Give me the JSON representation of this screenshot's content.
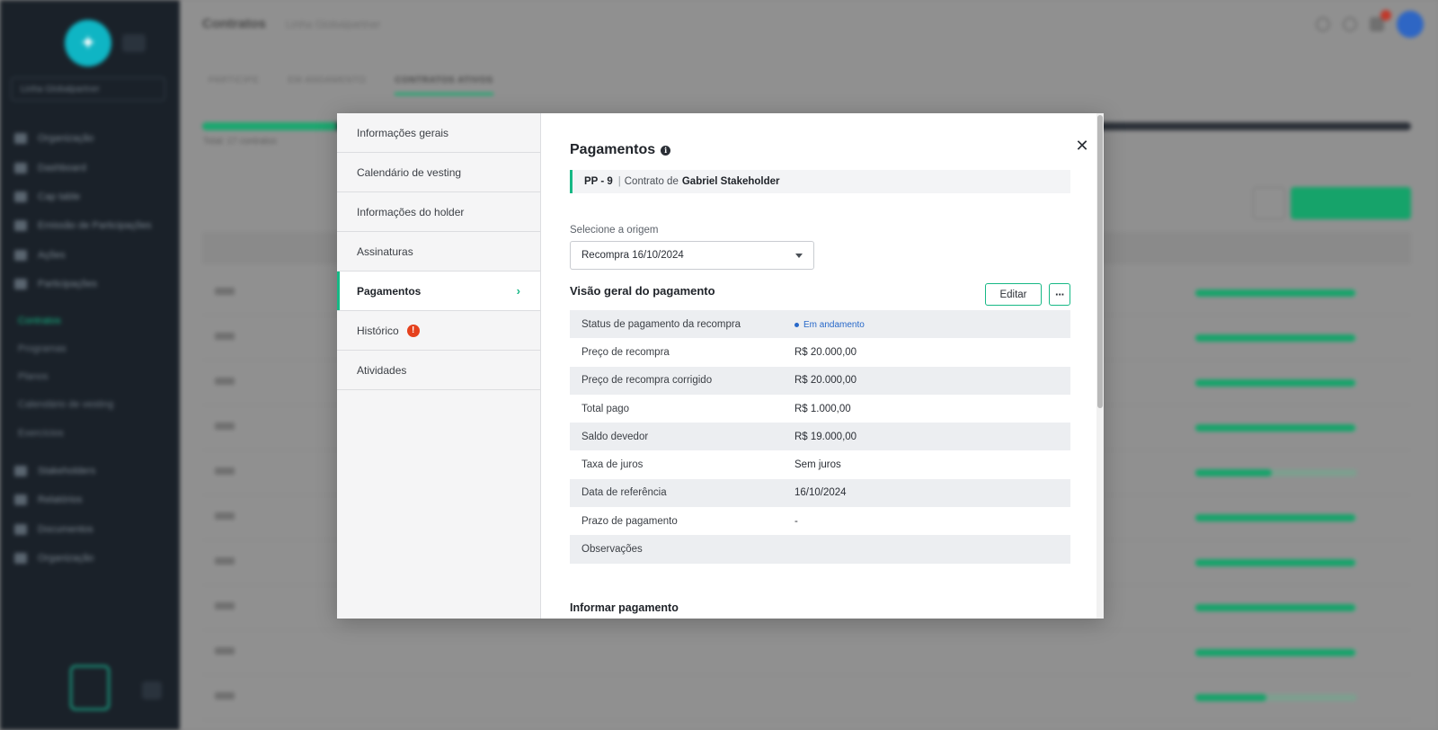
{
  "background": {
    "page_title": "Contratos",
    "page_subtitle": "Linha Globalpartner",
    "tabs": [
      "PARTICIPE",
      "EM ANDAMENTO",
      "CONTRATOS ATIVOS"
    ],
    "total_label": "Total: 17 contratos",
    "sidebar": {
      "org_select": "Linha Globalpartner",
      "items": [
        "Organização",
        "Dashboard",
        "Cap table",
        "Emissão de Participações",
        "Ações",
        "Participações"
      ],
      "sub_items": [
        "Contratos",
        "Programas",
        "Planos",
        "Calendário de vesting",
        "Exercícios"
      ],
      "bottom_items": [
        "Stakeholders",
        "Relatórios",
        "Documentos",
        "Organização"
      ]
    },
    "row_progress": [
      0.99,
      0.99,
      0.99,
      0.99,
      0.47,
      0.99,
      0.99,
      0.99,
      0.99,
      0.44
    ]
  },
  "modal": {
    "nav": [
      {
        "label": "Informações gerais"
      },
      {
        "label": "Calendário de vesting"
      },
      {
        "label": "Informações do holder"
      },
      {
        "label": "Assinaturas"
      },
      {
        "label": "Pagamentos"
      },
      {
        "label": "Histórico"
      },
      {
        "label": "Atividades"
      }
    ],
    "history_alert": "!",
    "title": "Pagamentos",
    "contract": {
      "code": "PP - 9",
      "separator": "|",
      "prefix": "Contrato de",
      "holder": "Gabriel Stakeholder"
    },
    "origin": {
      "label": "Selecione a origem",
      "value": "Recompra 16/10/2024"
    },
    "overview": {
      "title": "Visão geral do pagamento",
      "edit_label": "Editar",
      "more_label": "···",
      "rows": [
        {
          "key": "Status de pagamento da recompra",
          "value": "Em andamento"
        },
        {
          "key": "Preço de recompra",
          "value": "R$ 20.000,00"
        },
        {
          "key": "Preço de recompra corrigido",
          "value": "R$ 20.000,00"
        },
        {
          "key": "Total pago",
          "value": "R$ 1.000,00"
        },
        {
          "key": "Saldo devedor",
          "value": "R$ 19.000,00"
        },
        {
          "key": "Taxa de juros",
          "value": "Sem juros"
        },
        {
          "key": "Data de referência",
          "value": "16/10/2024"
        },
        {
          "key": "Prazo de pagamento",
          "value": "-"
        },
        {
          "key": "Observações",
          "value": ""
        }
      ]
    },
    "inform_title": "Informar pagamento",
    "colors": {
      "accent": "#16b885",
      "status": "#2768c9",
      "alert": "#e5411d"
    }
  }
}
